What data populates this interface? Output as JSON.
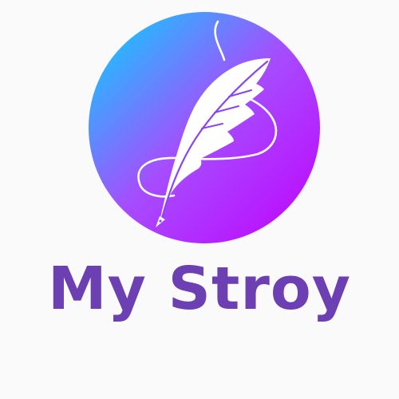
{
  "brand": {
    "name": "My Stroy",
    "text_color": "#6c3fb2"
  },
  "logo": {
    "icon": "feather-quill-icon",
    "gradient_start": "#00d9ff",
    "gradient_mid": "#a64dff",
    "gradient_end": "#c000ff",
    "feather_color": "#ffffff"
  },
  "background_color": "#fafafa"
}
